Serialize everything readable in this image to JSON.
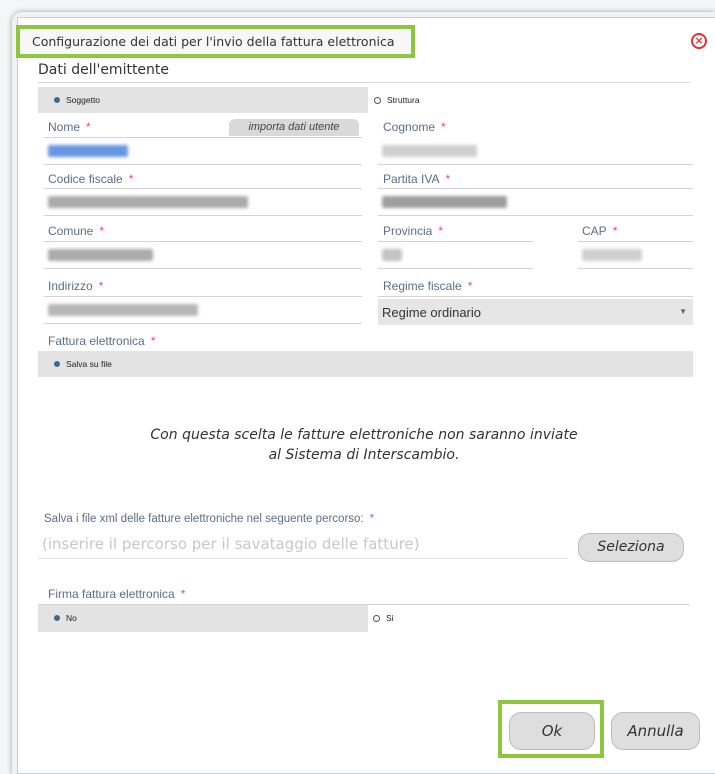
{
  "dialog": {
    "title": "Configurazione dei dati per l'invio della fattura elettronica",
    "close_icon": "close-circle-icon"
  },
  "emitter": {
    "section_title": "Dati dell'emittente",
    "type_options": [
      {
        "label": "Soggetto",
        "selected": true
      },
      {
        "label": "Struttura",
        "selected": false
      }
    ],
    "nome_label": "Nome",
    "import_button": "importa dati utente",
    "cognome_label": "Cognome",
    "codice_fiscale_label": "Codice fiscale",
    "partita_iva_label": "Partita IVA",
    "comune_label": "Comune",
    "provincia_label": "Provincia",
    "cap_label": "CAP",
    "indirizzo_label": "Indirizzo",
    "regime_label": "Regime fiscale",
    "regime_value": "Regime ordinario",
    "required_mark": "*"
  },
  "invoice": {
    "label": "Fattura elettronica",
    "option": "Salva su file",
    "message_line1": "Con questa scelta le fatture elettroniche non saranno inviate",
    "message_line2": "al Sistema di Interscambio.",
    "path_label": "Salva i file xml delle fatture elettroniche nel seguente percorso:",
    "path_placeholder": "(inserire il percorso per il savataggio delle fatture)",
    "select_button": "Seleziona"
  },
  "signature": {
    "label": "Firma fattura elettronica",
    "options": [
      {
        "label": "No",
        "selected": true
      },
      {
        "label": "Si",
        "selected": false
      }
    ]
  },
  "footer": {
    "ok_label": "Ok",
    "cancel_label": "Annulla"
  },
  "colors": {
    "highlight": "#8dc63f",
    "label": "#5a6f88",
    "required": "#e0506a",
    "radio_selected": "#3f6a8e"
  }
}
